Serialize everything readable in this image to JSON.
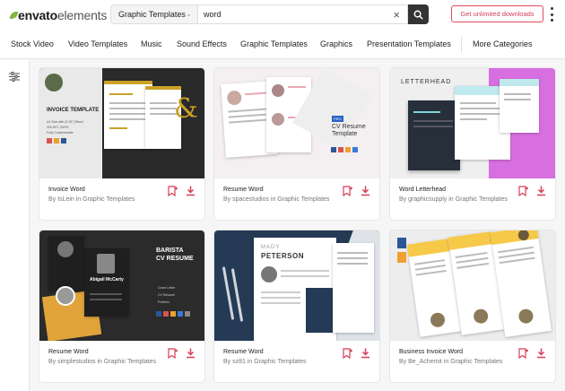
{
  "brand": {
    "bold": "envato",
    "light": "elements"
  },
  "search": {
    "category": "Graphic Templates",
    "query": "word",
    "cta_label": "Get unlimited downloads"
  },
  "nav": [
    "Stock Video",
    "Video Templates",
    "Music",
    "Sound Effects",
    "Graphic Templates",
    "Graphics",
    "Presentation Templates",
    "More Categories"
  ],
  "cards": [
    {
      "title": "Invoice Word",
      "by": "By IsLein in Graphic Templates",
      "thumb": {
        "heading": "INVOICE TEMPLATE",
        "lines": [
          "A4 Size with (0.25\") Bleed",
          "300 DPI, CMYK",
          "Fully Customizable"
        ],
        "ampersand": "&"
      }
    },
    {
      "title": "Resume Word",
      "by": "By spacestudios in Graphic Templates",
      "thumb": {
        "badge": "PRO",
        "heading": "CV Resume",
        "sub": "Template"
      }
    },
    {
      "title": "Word Letterhead",
      "by": "By graphicsupply in Graphic Templates",
      "thumb": {
        "heading": "LETTERHEAD"
      }
    },
    {
      "title": "Resume Word",
      "by": "By simplestudios in Graphic Templates",
      "thumb": {
        "heading": "BARISTA",
        "sub": "CV RESUME",
        "name": "Abigail McCarty",
        "list": [
          "Cover Letter",
          "CV Resume",
          "Portfolio"
        ]
      }
    },
    {
      "title": "Resume Word",
      "by": "By sz81 in Graphic Templates",
      "thumb": {
        "first": "MADY",
        "last": "PETERSON"
      }
    },
    {
      "title": "Business Invoice Word",
      "by": "By Be_Achemit in Graphic Templates",
      "thumb": {}
    }
  ],
  "colors": {
    "accent": "#d43f56",
    "logo_green": "#82b541",
    "dark": "#333333"
  }
}
